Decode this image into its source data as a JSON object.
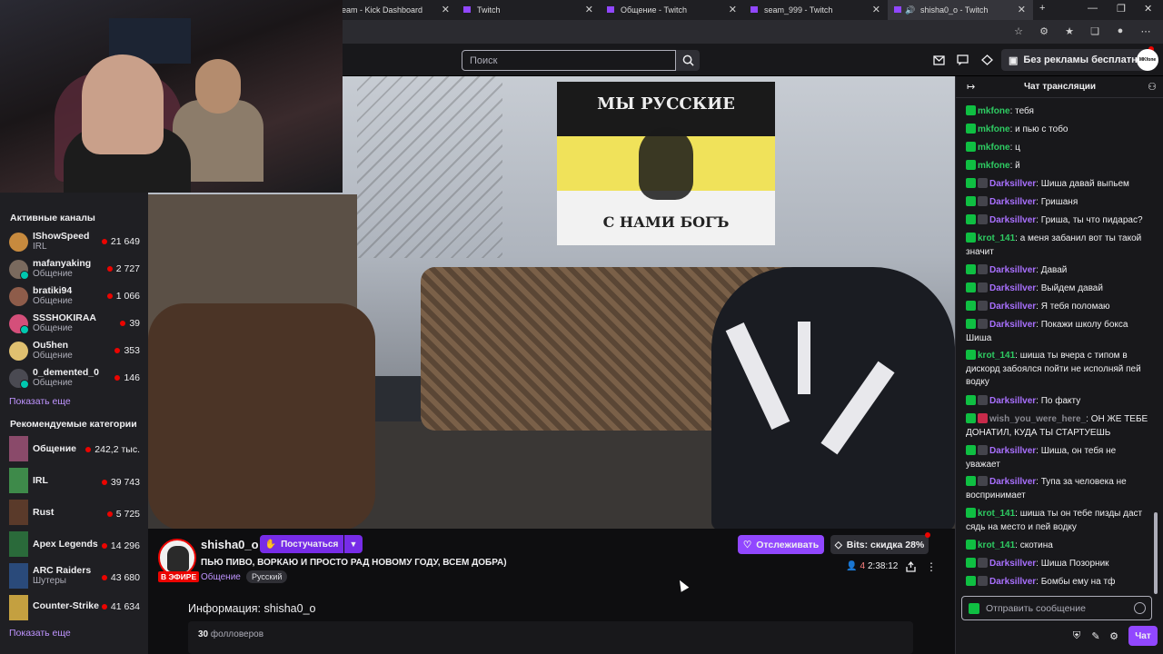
{
  "browser": {
    "tabs": [
      {
        "label": "eam - Kick Dashboard",
        "active": false
      },
      {
        "label": "Twitch",
        "active": false
      },
      {
        "label": "Общение - Twitch",
        "active": false
      },
      {
        "label": "seam_999 - Twitch",
        "active": false
      },
      {
        "label": "shisha0_o - Twitch",
        "active": true
      }
    ],
    "new_tab": "+",
    "controls": {
      "minimize": "—",
      "restore": "❐",
      "close": "✕"
    }
  },
  "topnav": {
    "search_placeholder": "Поиск",
    "no_ads_label": "Без рекламы бесплатно",
    "avatar_text": "MKfone"
  },
  "sidebar": {
    "active_title": "Активные каналы",
    "channels": [
      {
        "name": "IShowSpeed",
        "category": "IRL",
        "viewers": "21 649",
        "color": "#c78a3e"
      },
      {
        "name": "mafanyaking",
        "category": "Общение",
        "viewers": "2 727",
        "color": "#7a6a5e"
      },
      {
        "name": "bratiki94",
        "category": "Общение",
        "viewers": "1 066",
        "color": "#8e5c4a"
      },
      {
        "name": "SSSHOKIRAA",
        "category": "Общение",
        "viewers": "39",
        "color": "#d44f7a"
      },
      {
        "name": "Ou5hen",
        "category": "Общение",
        "viewers": "353",
        "color": "#e0c070"
      },
      {
        "name": "0_demented_0",
        "category": "Общение",
        "viewers": "146",
        "color": "#4a4a52"
      }
    ],
    "show_more": "Показать еще",
    "rec_title": "Рекомендуемые категории",
    "categories": [
      {
        "name": "Общение",
        "sub": "",
        "viewers": "242,2 тыс.",
        "color": "#8a4a6a"
      },
      {
        "name": "IRL",
        "sub": "",
        "viewers": "39 743",
        "color": "#3e8a4a"
      },
      {
        "name": "Rust",
        "sub": "",
        "viewers": "5 725",
        "color": "#5a3a2a"
      },
      {
        "name": "Apex Legends",
        "sub": "",
        "viewers": "14 296",
        "color": "#2a6a3a"
      },
      {
        "name": "ARC Raiders",
        "sub": "Шутеры",
        "viewers": "43 680",
        "color": "#2a4a7a"
      },
      {
        "name": "Counter-Strike",
        "sub": "",
        "viewers": "41 634",
        "color": "#c4a040"
      }
    ],
    "show_more2": "Показать еще"
  },
  "video": {
    "flag_top": "МЫ РУССКИЕ",
    "flag_bottom": "С НАМИ БОГЪ"
  },
  "channel": {
    "name": "shisha0_o",
    "live_label": "В ЭФИРЕ",
    "knock_label": "Постучаться",
    "title": "ПЬЮ ПИВО, ВОРКАЮ И ПРОСТО РАД НОВОМУ ГОДУ, ВСЕМ ДОБРА)",
    "category": "Общение",
    "tag": "Русский",
    "follow_label": "Отслеживать",
    "bits_label": "Bits: скидка 28%",
    "viewers": "4",
    "uptime": "2:38:12",
    "info_title": "Информация: shisha0_o",
    "followers_count": "30",
    "followers_label": "фолловеров"
  },
  "chat": {
    "title": "Чат трансляции",
    "input_placeholder": "Отправить сообщение",
    "send_label": "Чат",
    "messages": [
      {
        "badges": [
          "check"
        ],
        "user": "mkfone",
        "color": "green",
        "text": ": тебя"
      },
      {
        "badges": [
          "check"
        ],
        "user": "mkfone",
        "color": "green",
        "text": ": и пью с тобо"
      },
      {
        "badges": [
          "check"
        ],
        "user": "mkfone",
        "color": "green",
        "text": ": ц"
      },
      {
        "badges": [
          "check"
        ],
        "user": "mkfone",
        "color": "green",
        "text": ": й"
      },
      {
        "badges": [
          "check",
          "sub"
        ],
        "user": "Darksillver",
        "color": "purple",
        "text": ": Шиша давай выпьем"
      },
      {
        "badges": [
          "check",
          "sub"
        ],
        "user": "Darksillver",
        "color": "purple",
        "text": ": Гришаня"
      },
      {
        "badges": [
          "check",
          "sub"
        ],
        "user": "Darksillver",
        "color": "purple",
        "text": ": Гриша, ты что пидарас?"
      },
      {
        "badges": [
          "check"
        ],
        "user": "krot_141",
        "color": "green",
        "text": ": а меня забанил вот ты такой значит"
      },
      {
        "badges": [
          "check",
          "sub"
        ],
        "user": "Darksillver",
        "color": "purple",
        "text": ": Давай"
      },
      {
        "badges": [
          "check",
          "sub"
        ],
        "user": "Darksillver",
        "color": "purple",
        "text": ": Выйдем давай"
      },
      {
        "badges": [
          "check",
          "sub"
        ],
        "user": "Darksillver",
        "color": "purple",
        "text": ": Я тебя поломаю"
      },
      {
        "badges": [
          "check",
          "sub"
        ],
        "user": "Darksillver",
        "color": "purple",
        "text": ": Покажи школу бокса Шиша"
      },
      {
        "badges": [
          "check"
        ],
        "user": "krot_141",
        "color": "green",
        "text": ": шиша ты вчера с типом в дискорд забоялся пойти не исполняй пей водку"
      },
      {
        "badges": [
          "check",
          "sub"
        ],
        "user": "Darksillver",
        "color": "purple",
        "text": ": По факту"
      },
      {
        "badges": [
          "check",
          "x"
        ],
        "user": "wish_you_were_here_",
        "color": "grey",
        "text": ": ОН ЖЕ ТЕБЕ ДОНАТИЛ, КУДА ТЫ СТАРТУЕШЬ"
      },
      {
        "badges": [
          "check",
          "sub"
        ],
        "user": "Darksillver",
        "color": "purple",
        "text": ": Шиша, он тебя не уважает"
      },
      {
        "badges": [
          "check",
          "sub"
        ],
        "user": "Darksillver",
        "color": "purple",
        "text": ": Тупа за человека не воспринимает"
      },
      {
        "badges": [
          "check"
        ],
        "user": "krot_141",
        "color": "green",
        "text": ": шиша ты он тебе пизды даст сядь на место и пей водку"
      },
      {
        "badges": [
          "check"
        ],
        "user": "krot_141",
        "color": "green",
        "text": ": скотина"
      },
      {
        "badges": [
          "check",
          "sub"
        ],
        "user": "Darksillver",
        "color": "purple",
        "text": ": Шиша Позорник"
      },
      {
        "badges": [
          "check",
          "sub"
        ],
        "user": "Darksillver",
        "color": "purple",
        "text": ": Бомбы ему на тф"
      }
    ]
  }
}
